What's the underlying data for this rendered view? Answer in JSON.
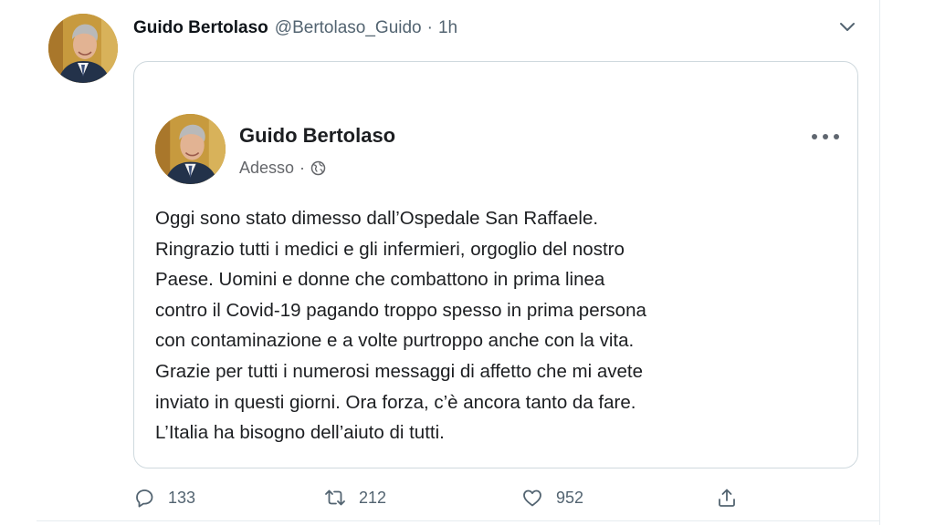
{
  "tweet": {
    "author_name": "Guido Bertolaso",
    "handle": "@Bertolaso_Guido",
    "separator": "·",
    "time": "1h",
    "avatar_icon": "profile-photo",
    "menu_icon": "chevron-down-icon"
  },
  "embedded_post": {
    "author_name": "Guido Bertolaso",
    "time": "Adesso",
    "separator": "·",
    "audience_icon": "globe-icon",
    "more_icon": "more-horizontal-icon",
    "text_lines": [
      "Oggi sono stato dimesso dall’Ospedale San Raffaele.",
      "Ringrazio tutti i medici e gli infermieri, orgoglio del nostro",
      "Paese. Uomini e donne che combattono in prima linea",
      "contro il Covid-19 pagando troppo spesso in prima persona",
      "con contaminazione e a volte purtroppo anche con la vita.",
      "Grazie per tutti i numerosi messaggi di affetto che mi avete",
      "inviato in questi giorni. Ora forza, c’è ancora tanto da fare.",
      "L’Italia ha bisogno dell’aiuto di tutti."
    ]
  },
  "actions": {
    "reply": {
      "icon": "reply-icon",
      "count": "133"
    },
    "retweet": {
      "icon": "retweet-icon",
      "count": "212"
    },
    "like": {
      "icon": "heart-icon",
      "count": "952"
    },
    "share": {
      "icon": "share-icon"
    }
  },
  "colors": {
    "text_primary": "#0f1419",
    "text_secondary": "#536471",
    "card_border": "#cfd9de",
    "facebook_text": "#1c1e21",
    "facebook_meta": "#65676b"
  }
}
